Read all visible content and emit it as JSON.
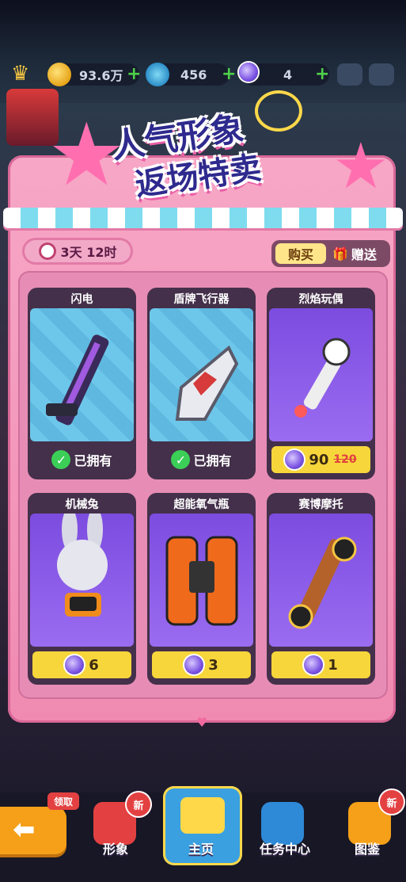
{
  "resources": {
    "coins": "93.6万",
    "keys": "456",
    "gems": "4"
  },
  "shop": {
    "title_line1": "人气形象",
    "title_line2": "返场特卖",
    "timer": "3天 12时",
    "tab_buy": "购买",
    "tab_gift": "赠送",
    "items": [
      {
        "name": "闪电",
        "status": "已拥有",
        "art": "hoverboard-purple-icon"
      },
      {
        "name": "盾牌飞行器",
        "status": "已拥有",
        "art": "shield-flyer-icon"
      },
      {
        "name": "烈焰玩偶",
        "price": "90",
        "old_price": "120",
        "art": "flame-doll-icon"
      },
      {
        "name": "机械兔",
        "price": "6",
        "art": "mech-rabbit-icon"
      },
      {
        "name": "超能氧气瓶",
        "price": "3",
        "art": "oxygen-tank-icon"
      },
      {
        "name": "赛博摩托",
        "price": "1",
        "art": "cyber-moto-icon"
      }
    ]
  },
  "bottom_nav": {
    "tabs": [
      {
        "label": "形象",
        "badge": "新",
        "tag": "领取"
      },
      {
        "label": "主页"
      },
      {
        "label": "任务中心"
      },
      {
        "label": "图鉴",
        "badge": "新"
      }
    ]
  },
  "colors": {
    "panel_pink": "#f08ab1",
    "price_yellow": "#f7d63b",
    "owned_green": "#3bcf57",
    "title_blue": "#2e2a8e"
  }
}
